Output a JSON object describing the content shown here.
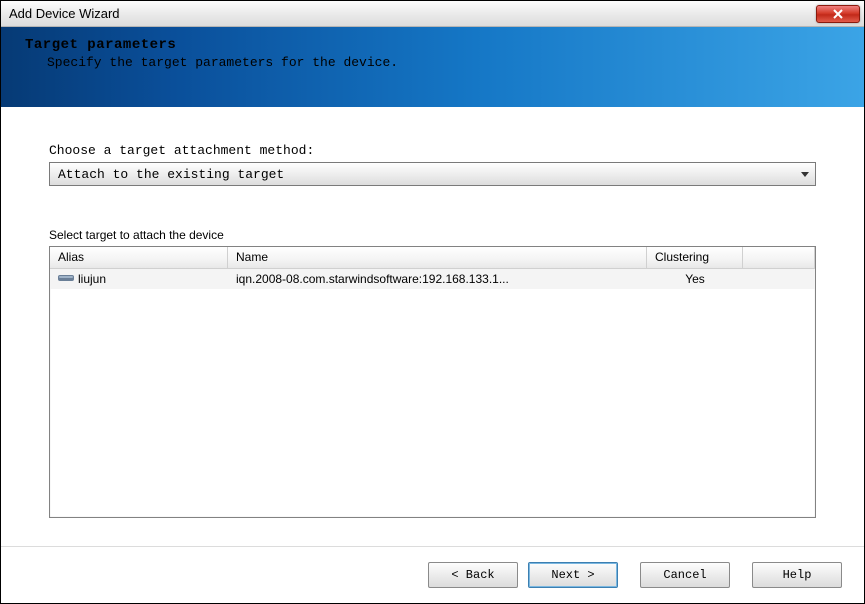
{
  "window": {
    "title": "Add Device Wizard"
  },
  "banner": {
    "title": "Target parameters",
    "subtitle": "Specify the target parameters for the device."
  },
  "attach": {
    "label": "Choose a target attachment method:",
    "selected": "Attach to the existing target"
  },
  "targetList": {
    "label": "Select target to attach the device",
    "columns": {
      "alias": "Alias",
      "name": "Name",
      "clustering": "Clustering"
    },
    "rows": [
      {
        "alias": "liujun",
        "name": "iqn.2008-08.com.starwindsoftware:192.168.133.1...",
        "clustering": "Yes"
      }
    ]
  },
  "buttons": {
    "back": "< Back",
    "next": "Next >",
    "cancel": "Cancel",
    "help": "Help"
  }
}
